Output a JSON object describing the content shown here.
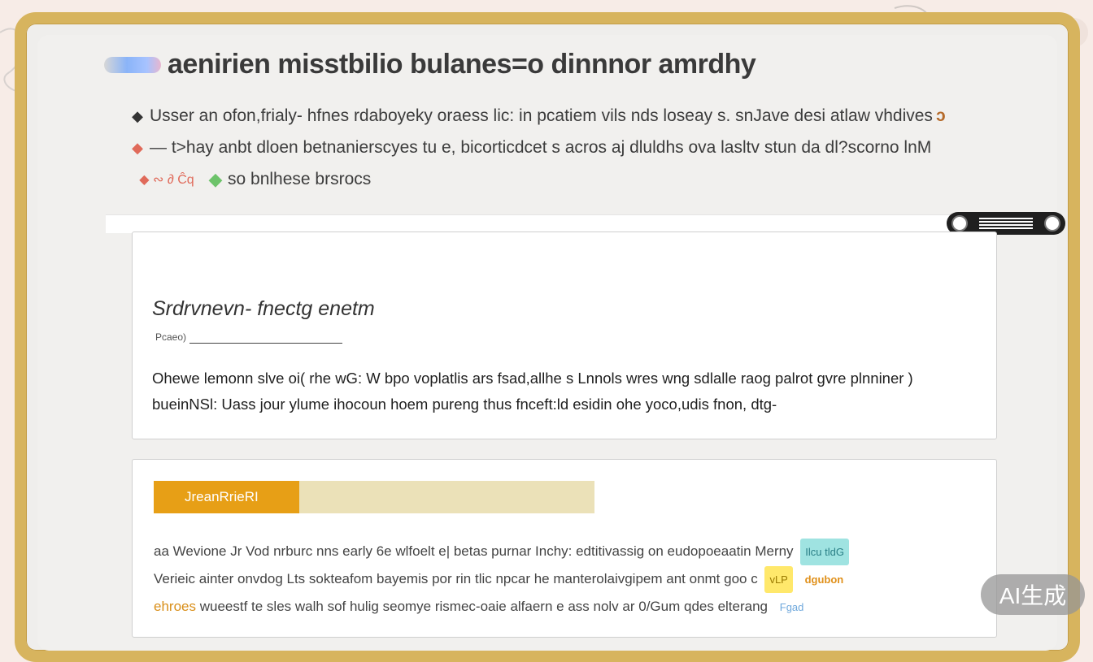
{
  "title": "aenirien misstbilio bulanes=o dinnnor amrdhy",
  "intro": {
    "line1": "Usser an ofon,frialy- hfnes rdaboyeky oraess lic: in pcatiem vils nds loseay s. snJave desi atlaw vhdives",
    "line2": "— t>hay anbt dloen betnanierscyes tu e, bicorticdcet s acros aj dluldhs ova lasltv stun da dl?scorno lnM",
    "line3": "so bnlhese brsrocs"
  },
  "card1": {
    "heading": "Srdrvnevn- fnectg enetm",
    "sub": "Pcaeo)",
    "body_line1": "Ohewe lemonn slve oi( rhe wG: W bpo voplatlis ars fsad,allhe s Lnnols wres wng sdlalle raog palrot gvre plnniner )",
    "body_line2": "bueinNSl: Uass jour ylume ihocoun hoem pureng thus fnceft:ld esidin ohe yoco,udis fnon, dtg-"
  },
  "card2": {
    "progress_label": "JreanRrieRI",
    "progress_percent": 33,
    "line1": "aa Wevione Jr Vod nrburc nns early 6e wlfoelt e| betas purnar Inchy: edtitivassig on eudopoeaatin Merny",
    "line2": "Verieic ainter onvdog Lts sokteafom bayemis por rin tlic npcar he manterolaivgipem ant onmt goo c",
    "line3_prefix": "ehroes",
    "line3": "wueestf te sles walh sof hulig seomye rismec-oaie alfaern e ass nolv ar 0/Gum qdes elterang",
    "tag1": "Ilcu tldG",
    "tag2": "vLP",
    "tag3": "dgubon",
    "tag4": "Fgad"
  },
  "badge": "AI生成",
  "colors": {
    "frame": "#d7b45e",
    "progress": "#e79f16",
    "progress_track": "#ebe1b8",
    "accent_red": "#e06a5a",
    "accent_green": "#6dc36a"
  },
  "icons": [
    "diamond-icon",
    "bracket-icon",
    "scribble-icon",
    "leaf-icon",
    "scroll-knob-icon"
  ]
}
